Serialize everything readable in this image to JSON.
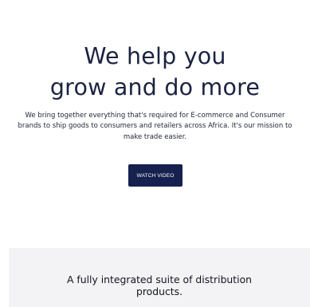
{
  "hero": {
    "title_line1": "We help you",
    "title_line2": "grow and do more",
    "description": "We bring together everything that's required for E-commerce and Consumer brands to ship goods to consumers and retailers across Africa. It's our mission to make trade easier.",
    "watch_video_label": "WATCH VIDEO"
  },
  "products": {
    "title_line1": "A fully integrated suite of distribution",
    "title_line2": "products."
  },
  "colors": {
    "primary_navy": "#17214f",
    "section_gray": "#f3f3f5",
    "text_dark": "#1b2340"
  }
}
